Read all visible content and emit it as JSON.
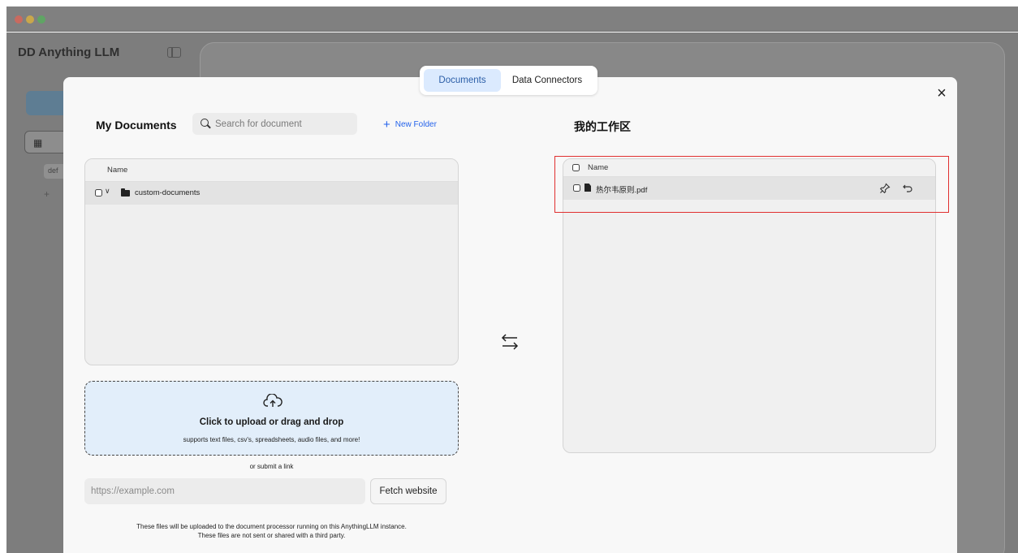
{
  "app": {
    "brand": "DD Anything LLM",
    "sidebar_sub": "def"
  },
  "modal": {
    "tabs": [
      "Documents",
      "Data Connectors"
    ],
    "close_symbol": "×",
    "left": {
      "title": "My Documents",
      "search_placeholder": "Search for document",
      "new_folder_label": "New Folder",
      "column_name": "Name",
      "folders": [
        {
          "name": "custom-documents"
        }
      ]
    },
    "upload": {
      "title": "Click to upload or drag and drop",
      "subtitle": "supports text files, csv's, spreadsheets, audio files, and more!",
      "or_link": "or submit a link",
      "link_placeholder": "https://example.com",
      "fetch_label": "Fetch website",
      "footnote_line1": "These files will be uploaded to the document processor running on this AnythingLLM instance.",
      "footnote_line2": "These files are not sent or shared with a third party."
    },
    "right": {
      "title": "我的工作区",
      "column_name": "Name",
      "files": [
        {
          "name": "热尔韦原则.pdf"
        }
      ]
    }
  },
  "icons": [
    "search-icon",
    "plus-icon",
    "folder-icon",
    "chevron-down-icon",
    "cloud-upload-icon",
    "transfer-arrows-icon",
    "file-icon",
    "pin-icon",
    "undo-icon",
    "close-icon",
    "sidebar-toggle-icon"
  ],
  "colors": {
    "accent": "#2563eb",
    "tab_active_bg": "#dbeafe",
    "upload_bg": "#e2eefa",
    "highlight": "#e03030"
  }
}
